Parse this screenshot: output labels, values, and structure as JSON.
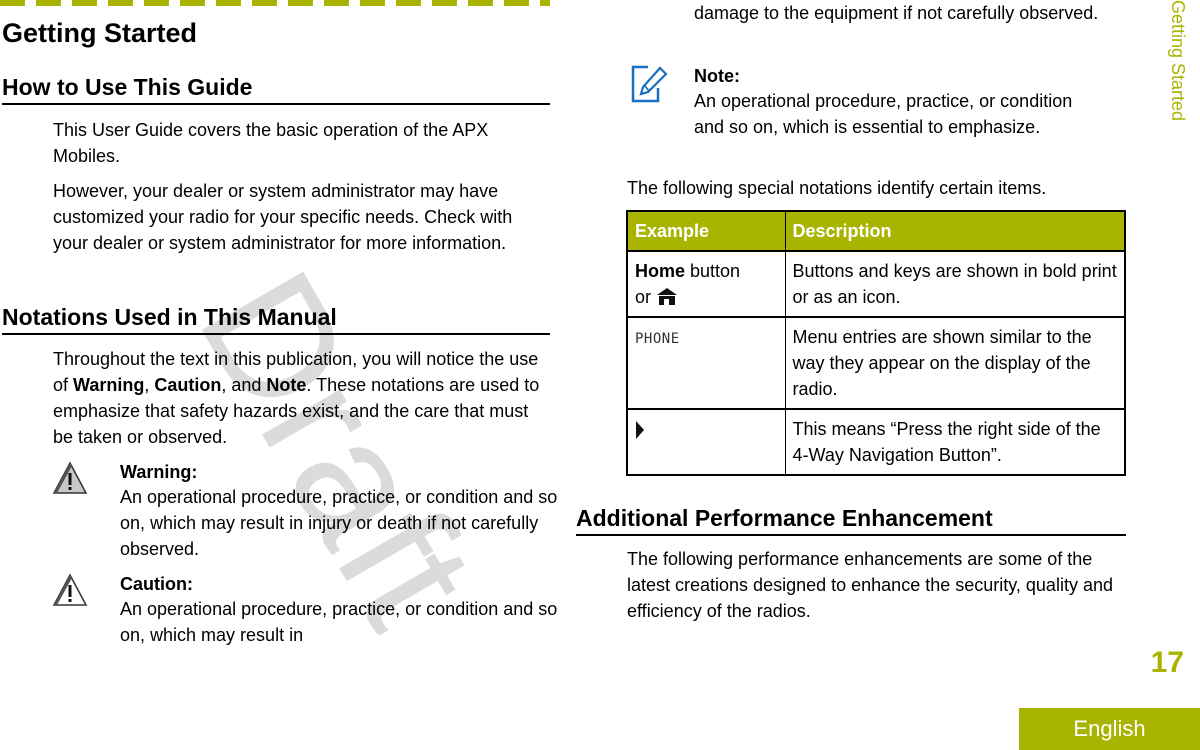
{
  "page": {
    "chapter_title": "Getting Started",
    "side_tab_label": "Getting Started",
    "page_number": "17",
    "language_tab": "English",
    "watermark": "Draft",
    "accent_color": "#a8b400",
    "note_icon_color": "#1a6fc0"
  },
  "sections": {
    "how_to_use": {
      "heading": "How to Use This Guide",
      "paragraphs": [
        "This User Guide covers the basic operation of the APX Mobiles.",
        "However, your dealer or system administrator may have customized your radio for your specific needs. Check with your dealer or system administrator for more information."
      ]
    },
    "notations": {
      "heading": "Notations Used in This Manual",
      "intro_parts": {
        "p1": "Throughout the text in this publication, you will notice the use of ",
        "b1": "Warning",
        "s1": ", ",
        "b2": "Caution",
        "s2": ", and ",
        "b3": "Note",
        "p2": ". These notations are used to emphasize that safety hazards exist, and the care that must be taken or observed."
      },
      "warning": {
        "icon": "warning-triangle-icon",
        "title": "Warning:",
        "body": "An operational procedure, practice, or condition and so on, which may result in injury or death if not carefully observed."
      },
      "caution": {
        "icon": "caution-triangle-icon",
        "title": "Caution:",
        "body": "An operational procedure, practice, or condition and so on, which may result in",
        "body_continued": "damage to the equipment if not carefully observed."
      },
      "note": {
        "icon": "note-pencil-icon",
        "title": "Note:",
        "body": "An operational procedure, practice, or condition and so on, which is essential to emphasize."
      },
      "table_intro": "The following special notations identify certain items.",
      "table": {
        "headers": [
          "Example",
          "Description"
        ],
        "rows": [
          {
            "example_bold": "Home",
            "example_rest": " button",
            "example_line2": "or ",
            "example_icon": "home-icon",
            "description": "Buttons and keys are shown in bold print or as an icon."
          },
          {
            "example_menu": "PHONE",
            "description": "Menu entries are shown similar to the way they appear on the display of the radio."
          },
          {
            "example_icon": "right-arrow-icon",
            "description": "This means “Press the right side of the 4-Way Navigation Button”."
          }
        ]
      }
    },
    "additional": {
      "heading": "Additional Performance Enhancement",
      "paragraph": "The following performance enhancements are some of the latest creations designed to enhance the security, quality and efficiency of the radios."
    }
  }
}
